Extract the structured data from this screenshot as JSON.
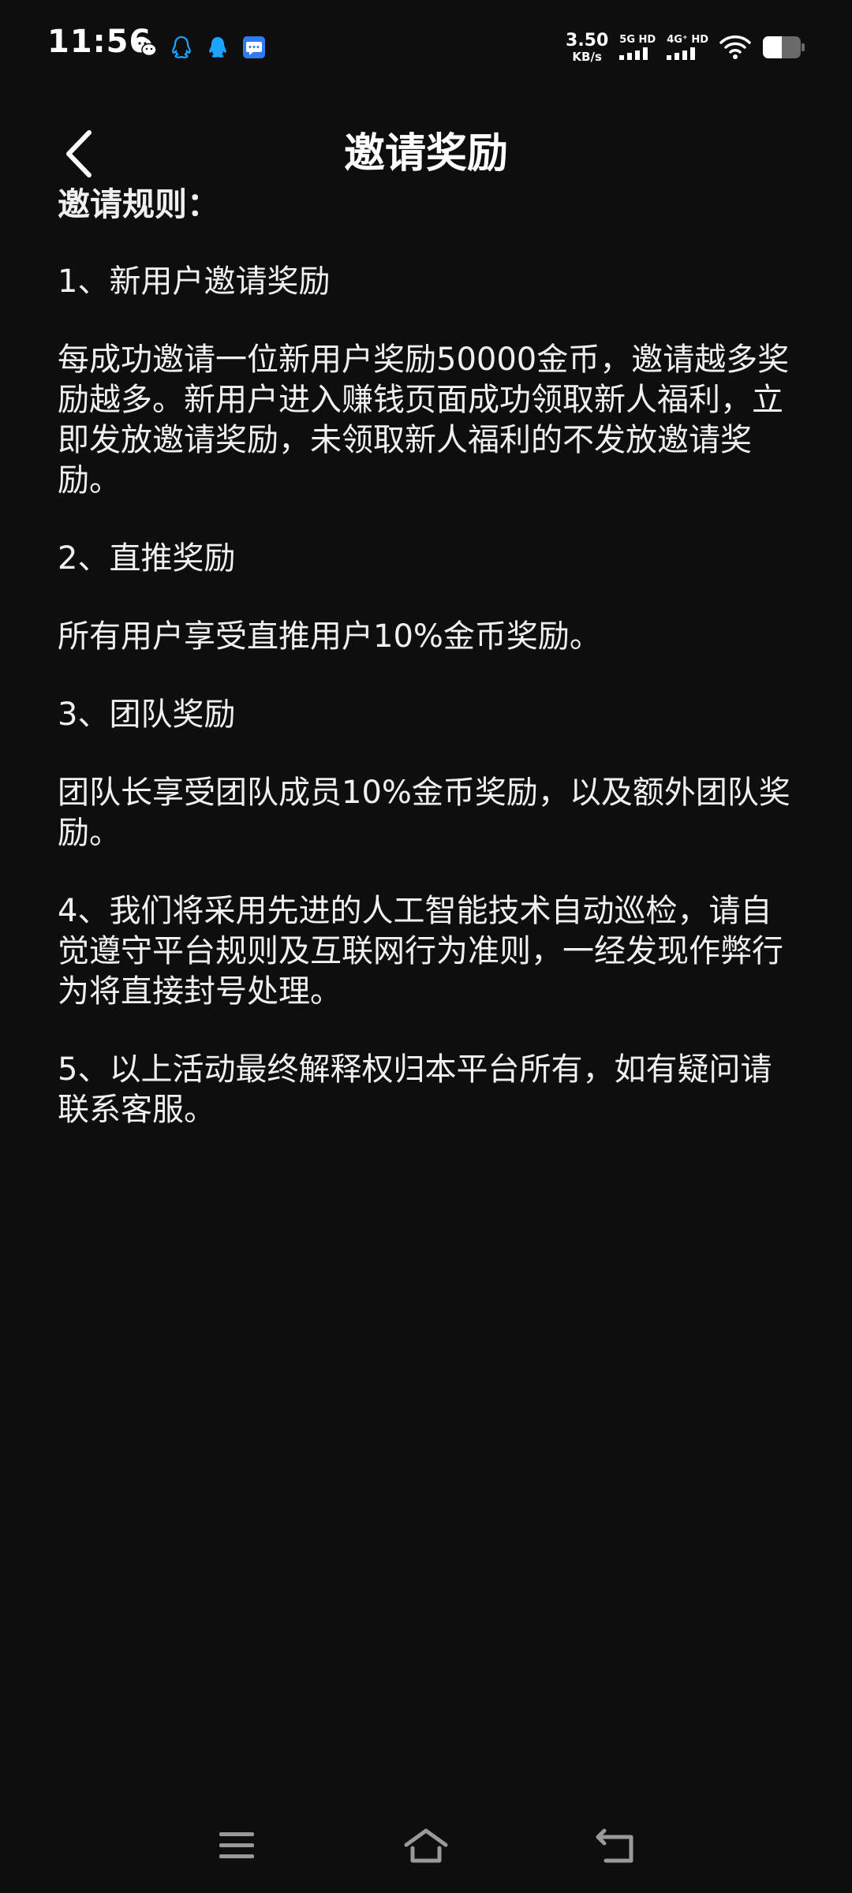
{
  "status_bar": {
    "time": "11:56",
    "net_speed_value": "3.50",
    "net_speed_unit": "KB/s",
    "sim1_label": "5G HD",
    "sim2_label": "4G⁺ HD",
    "app_icons": [
      "wechat-icon",
      "qq-outline-icon",
      "qq-icon",
      "message-icon"
    ],
    "colors": {
      "qq": "#1aa3ff",
      "message": "#2f7bf5"
    }
  },
  "header": {
    "title": "邀请奖励"
  },
  "content": {
    "heading": "邀请规则：",
    "paragraphs": [
      "1、新用户邀请奖励",
      "每成功邀请一位新用户奖励50000金币，邀请越多奖励越多。新用户进入赚钱页面成功领取新人福利，立即发放邀请奖励，未领取新人福利的不发放邀请奖励。",
      "2、直推奖励",
      "所有用户享受直推用户10%金币奖励。",
      "3、团队奖励",
      "团队长享受团队成员10%金币奖励，以及额外团队奖励。",
      "4、我们将采用先进的人工智能技术自动巡检，请自觉遵守平台规则及互联网行为准则，一经发现作弊行为将直接封号处理。",
      "5、以上活动最终解释权归本平台所有，如有疑问请联系客服。"
    ]
  },
  "nav_bar": {
    "icons": [
      "menu-icon",
      "home-icon",
      "back-icon"
    ]
  }
}
